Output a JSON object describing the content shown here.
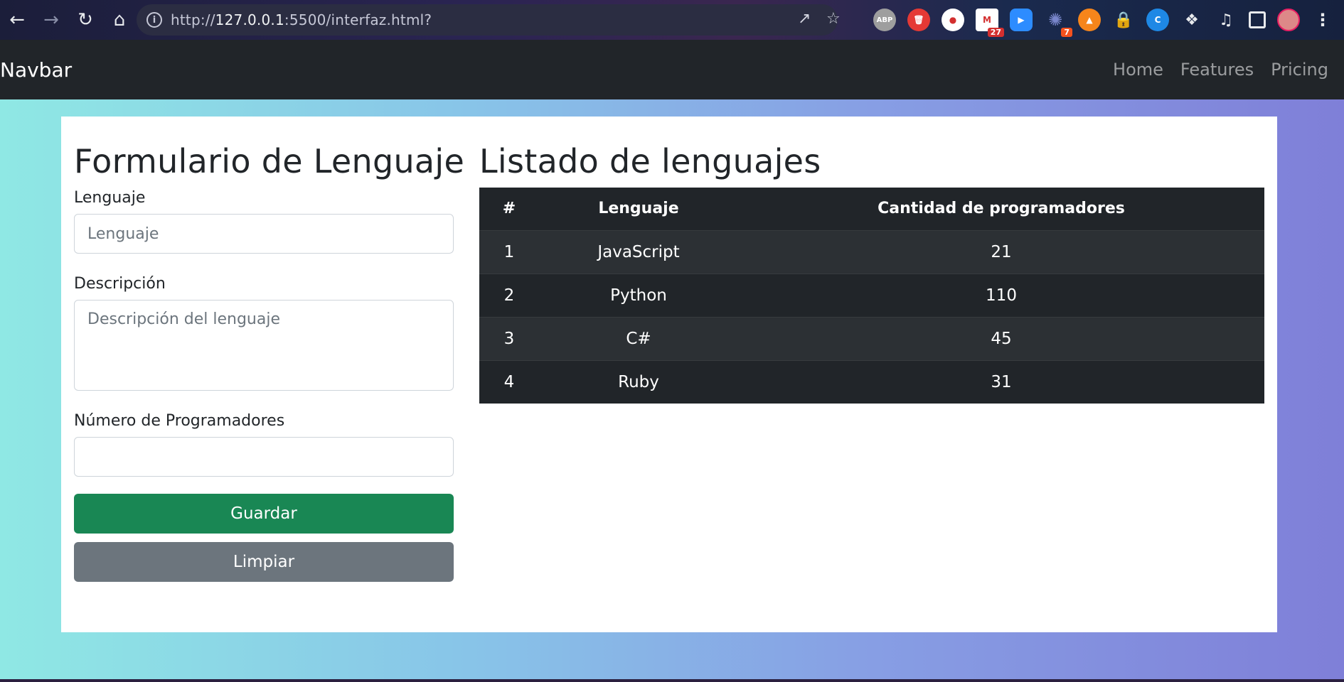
{
  "browser": {
    "url_prefix": "http://",
    "url_host": "127.0.0.1",
    "url_rest": ":5500/interfaz.html?",
    "extensions": [
      {
        "name": "adblock-icon",
        "label": "ABP",
        "color": "#9e9e9e"
      },
      {
        "name": "trash-extension-icon",
        "label": "",
        "color": "#e53935"
      },
      {
        "name": "opera-extension-icon",
        "label": "",
        "color": "#ffffff"
      },
      {
        "name": "gmail-checker-icon",
        "label": "",
        "color": "#d32f2f",
        "badge": "27"
      },
      {
        "name": "zoom-extension-icon",
        "label": "",
        "color": "#2d8cff"
      },
      {
        "name": "sparkle-extension-icon",
        "label": "",
        "color": "#5c6bc0",
        "badge": "7"
      },
      {
        "name": "metamask-icon",
        "label": "",
        "color": "#f6851b"
      },
      {
        "name": "lock-extension-icon",
        "label": "",
        "color": "#fbc02d"
      },
      {
        "name": "c-extension-icon",
        "label": "",
        "color": "#1e88e5"
      }
    ]
  },
  "navbar": {
    "brand": "Navbar",
    "links": [
      "Home",
      "Features",
      "Pricing"
    ]
  },
  "form": {
    "title": "Formulario de Lenguaje",
    "language_label": "Lenguaje",
    "language_placeholder": "Lenguaje",
    "description_label": "Descripción",
    "description_placeholder": "Descripción del lenguaje",
    "programmers_label": "Número de Programadores",
    "programmers_value": "",
    "save_label": "Guardar",
    "clear_label": "Limpiar"
  },
  "list": {
    "title": "Listado de lenguajes",
    "headers": [
      "#",
      "Lenguaje",
      "Cantidad de programadores"
    ],
    "rows": [
      [
        "1",
        "JavaScript",
        "21"
      ],
      [
        "2",
        "Python",
        "110"
      ],
      [
        "3",
        "C#",
        "45"
      ],
      [
        "4",
        "Ruby",
        "31"
      ]
    ]
  }
}
